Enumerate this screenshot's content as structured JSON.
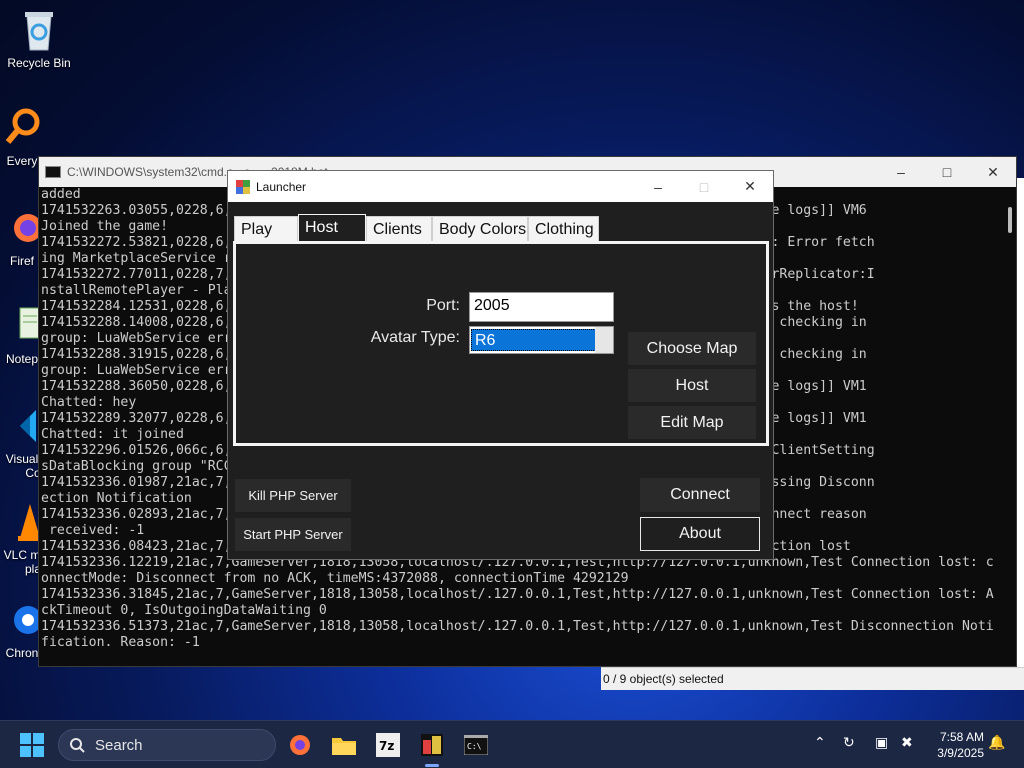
{
  "desktop": {
    "icons": [
      {
        "label": "Recycle Bin"
      },
      {
        "label": "Every"
      },
      {
        "label": "Firef"
      },
      {
        "label": "Notep"
      },
      {
        "label": "Visual"
      },
      {
        "label": "Co"
      },
      {
        "label": "VLC m"
      },
      {
        "label": "pla"
      },
      {
        "label": "Chron"
      }
    ]
  },
  "console": {
    "title": "C:\\WINDOWS\\system32\\cmd.e...e - ...2018M.bat",
    "lines": [
      "added",
      "1741532263.03055,0228,6,                                                     nown,Test [[game logs]] VM6",
      "Joined the game!",
      "1741532272.53821,0228,6,                                                     nown,Test Error: Error fetch",
      "ing MarketplaceService r                                                     PI Proxy calls.",
      "1741532272.77011,0228,7,                                                     nown,Test ServerReplicator:I",
      "nstallRemotePlayer - Pla",
      "1741532284.12531,0228,6,                                                     nown,Test VM6 is the host!",
      "1741532288.14008,0228,6,                                                     nown,Test Error checking in",
      "group: LuaWebService err",
      "1741532288.31915,0228,6,                                                     nown,Test Error checking in",
      "group: LuaWebService err",
      "1741532288.36050,0228,6,                                                     nown,Test [[game logs]] VM1",
      "Chatted: hey",
      "1741532289.32077,0228,6,                                                     nown,Test [[game logs]] VM1",
      "Chatted: it joined",
      "1741532296.01526,066c,6,                                                     nown,Test FetchClientSetting",
      "sDataBlocking group \"RCC",
      "1741532336.01987,21ac,7,                                                     nown,Test Processing Disconn",
      "ection Notification",
      "1741532336.02893,21ac,7,                                                     nown,Test Disconnect reason",
      " received: -1",
      "1741532336.08423,21ac,7,                                                     nown,Test Connection lost",
      "1741532336.12219,21ac,7,GameServer,1818,13058,localhost/.127.0.0.1,Test,http://127.0.0.1,unknown,Test Connection lost: c",
      "onnectMode: Disconnect from no ACK, timeMS:4372088, connectionTime 4292129",
      "1741532336.31845,21ac,7,GameServer,1818,13058,localhost/.127.0.0.1,Test,http://127.0.0.1,unknown,Test Connection lost: A",
      "ckTimeout 0, IsOutgoingDataWaiting 0",
      "1741532336.51373,21ac,7,GameServer,1818,13058,localhost/.127.0.0.1,Test,http://127.0.0.1,unknown,Test Disconnection Noti",
      "fication. Reason: -1"
    ]
  },
  "explorer": {
    "status": "0 / 9 object(s) selected"
  },
  "launcher": {
    "title": "Launcher",
    "tabs": [
      "Play",
      "Host",
      "Clients",
      "Body Colors",
      "Clothing"
    ],
    "active_tab": "Host",
    "port_label": "Port:",
    "port_value": "2005",
    "avatar_label": "Avatar Type:",
    "avatar_value": "R6",
    "buttons": {
      "choose_map": "Choose Map",
      "host": "Host",
      "edit_map": "Edit Map",
      "kill_php": "Kill PHP Server",
      "start_php": "Start PHP Server",
      "connect": "Connect",
      "about": "About"
    }
  },
  "taskbar": {
    "search_placeholder": "Search",
    "time": "7:58 AM",
    "date": "3/9/2025"
  },
  "colors": {
    "accent": "#0a74d8",
    "taskbar": "#1c2743",
    "console_bg": "#0c0c0c",
    "launcher_bg": "#1f1f1f"
  }
}
